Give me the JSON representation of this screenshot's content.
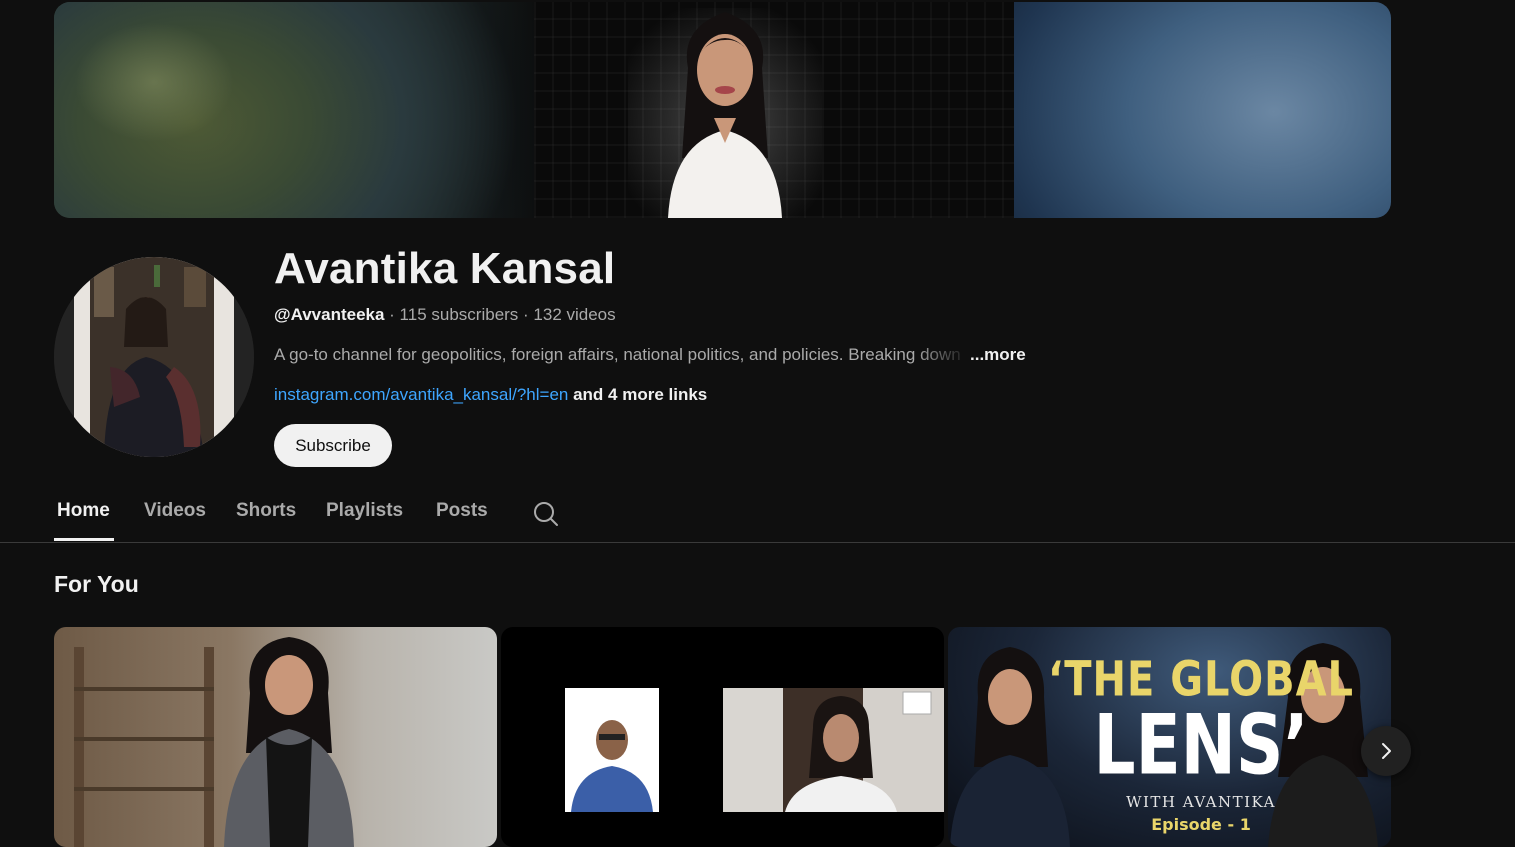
{
  "channel": {
    "name": "Avantika Kansal",
    "handle": "@Avvanteeka",
    "meta": " · 115 subscribers · 132 videos",
    "description": "A go-to channel for geopolitics, foreign affairs, national politics, and policies. Breaking down",
    "more_label": "...more",
    "link": "instagram.com/avantika_kansal/?hl=en",
    "more_links": " and 4 more links",
    "subscribe_label": "Subscribe"
  },
  "tabs": [
    {
      "label": "Home",
      "active": true
    },
    {
      "label": "Videos",
      "active": false
    },
    {
      "label": "Shorts",
      "active": false
    },
    {
      "label": "Playlists",
      "active": false
    },
    {
      "label": "Posts",
      "active": false
    }
  ],
  "section": {
    "title": "For You"
  },
  "thumbnails": [
    {
      "name": "video-thumb-1"
    },
    {
      "name": "video-thumb-2"
    },
    {
      "name": "video-thumb-3",
      "line1": "‘THE GLOBAL",
      "line2": "LENS’",
      "line3": "WITH AVANTIKA",
      "line4": "Episode - 1"
    }
  ],
  "icons": {
    "search": "search-icon",
    "next": "chevron-right-icon"
  },
  "colors": {
    "background": "#0f0f0f",
    "link": "#3ea6ff",
    "text": "#f1f1f1",
    "secondary_text": "#aaaaaa",
    "accent_gold": "#e9d56a"
  }
}
